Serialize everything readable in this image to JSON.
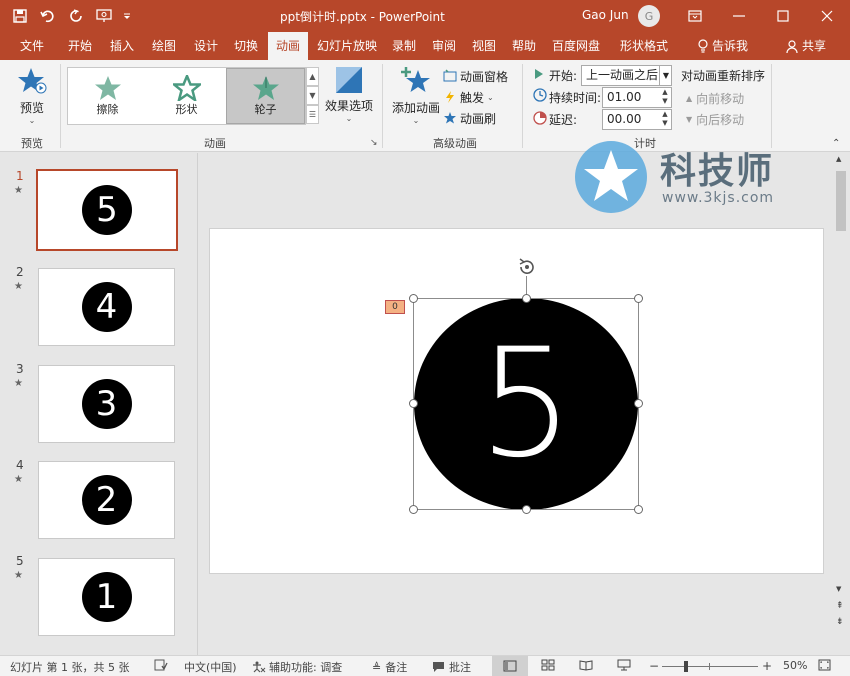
{
  "window": {
    "title": "ppt倒计时.pptx  -  PowerPoint",
    "user": "Gao Jun",
    "avatar_initial": "G"
  },
  "tabs": [
    {
      "label": "文件"
    },
    {
      "label": "开始"
    },
    {
      "label": "插入"
    },
    {
      "label": "绘图"
    },
    {
      "label": "设计"
    },
    {
      "label": "切换"
    },
    {
      "label": "动画"
    },
    {
      "label": "幻灯片放映"
    },
    {
      "label": "录制"
    },
    {
      "label": "审阅"
    },
    {
      "label": "视图"
    },
    {
      "label": "帮助"
    },
    {
      "label": "百度网盘"
    },
    {
      "label": "形状格式"
    },
    {
      "label": "告诉我"
    },
    {
      "label": "共享"
    }
  ],
  "ribbon": {
    "preview": {
      "button": "预览",
      "group": "预览"
    },
    "animation": {
      "gallery": [
        {
          "label": "擦除"
        },
        {
          "label": "形状"
        },
        {
          "label": "轮子"
        }
      ],
      "effect_options": "效果选项",
      "group": "动画"
    },
    "advanced": {
      "add_animation": "添加动画",
      "pane": "动画窗格",
      "trigger": "触发",
      "painter": "动画刷",
      "group": "高级动画"
    },
    "timing": {
      "start_label": "开始:",
      "start_value": "上一动画之后",
      "duration_label": "持续时间:",
      "duration_value": "01.00",
      "delay_label": "延迟:",
      "delay_value": "00.00",
      "group": "计时"
    },
    "reorder": {
      "title": "对动画重新排序",
      "earlier": "向前移动",
      "later": "向后移动"
    }
  },
  "slides": [
    {
      "num": "1",
      "digit": "5"
    },
    {
      "num": "2",
      "digit": "4"
    },
    {
      "num": "3",
      "digit": "3"
    },
    {
      "num": "4",
      "digit": "2"
    },
    {
      "num": "5",
      "digit": "1"
    }
  ],
  "canvas": {
    "digit": "5",
    "anim_tag": "0"
  },
  "watermark": {
    "title": "科技师",
    "url": "www.3kjs.com"
  },
  "status": {
    "slide_info": "幻灯片 第 1 张，共 5 张",
    "language": "中文(中国)",
    "accessibility": "辅助功能: 调查",
    "notes": "备注",
    "comments": "批注",
    "zoom": "50%"
  },
  "colors": {
    "accent": "#b7472a",
    "ribbon_bg": "#f3f3f3",
    "workspace_bg": "#e6e6e6"
  }
}
